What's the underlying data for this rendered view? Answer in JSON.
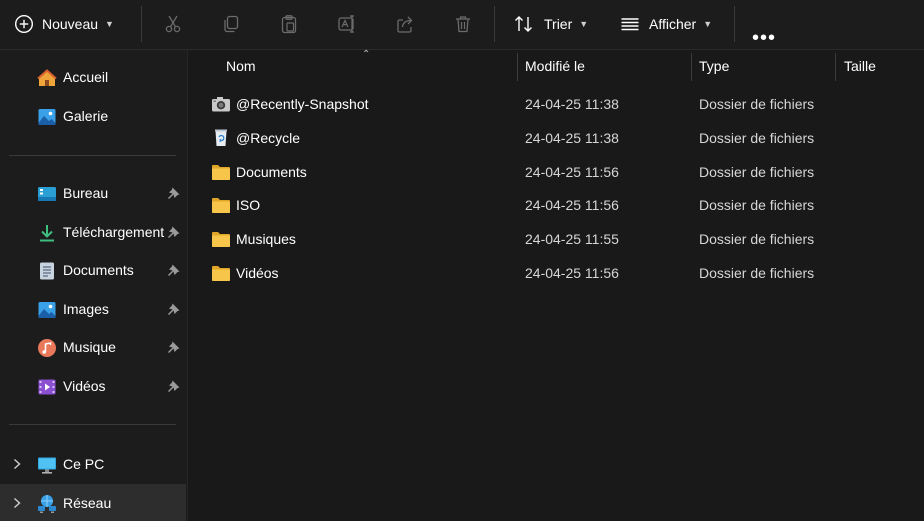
{
  "toolbar": {
    "new_label": "Nouveau",
    "sort_label": "Trier",
    "view_label": "Afficher",
    "more_label": "•••"
  },
  "sidebar": {
    "quick": [
      {
        "label": "Accueil",
        "icon": "home-icon"
      },
      {
        "label": "Galerie",
        "icon": "gallery-icon"
      }
    ],
    "pinned": [
      {
        "label": "Bureau",
        "icon": "desktop-icon"
      },
      {
        "label": "Téléchargement",
        "icon": "download-icon"
      },
      {
        "label": "Documents",
        "icon": "documents-icon"
      },
      {
        "label": "Images",
        "icon": "images-icon"
      },
      {
        "label": "Musique",
        "icon": "music-icon"
      },
      {
        "label": "Vidéos",
        "icon": "videos-icon"
      }
    ],
    "locations": [
      {
        "label": "Ce PC",
        "icon": "computer-icon"
      },
      {
        "label": "Réseau",
        "icon": "network-icon",
        "selected": true
      }
    ]
  },
  "columns": {
    "name": "Nom",
    "modified": "Modifié le",
    "type": "Type",
    "size": "Taille"
  },
  "files": [
    {
      "name": "@Recently-Snapshot",
      "modified": "24-04-25 11:38",
      "type": "Dossier de fichiers",
      "icon": "camera-icon"
    },
    {
      "name": "@Recycle",
      "modified": "24-04-25 11:38",
      "type": "Dossier de fichiers",
      "icon": "recycle-bin-icon"
    },
    {
      "name": "Documents",
      "modified": "24-04-25 11:56",
      "type": "Dossier de fichiers",
      "icon": "folder-icon"
    },
    {
      "name": "ISO",
      "modified": "24-04-25 11:56",
      "type": "Dossier de fichiers",
      "icon": "folder-icon"
    },
    {
      "name": "Musiques",
      "modified": "24-04-25 11:55",
      "type": "Dossier de fichiers",
      "icon": "folder-icon"
    },
    {
      "name": "Vidéos",
      "modified": "24-04-25 11:56",
      "type": "Dossier de fichiers",
      "icon": "folder-icon"
    }
  ],
  "colors": {
    "folder": "#f7c54a",
    "background": "#191919",
    "selected": "#2d2d2d"
  }
}
